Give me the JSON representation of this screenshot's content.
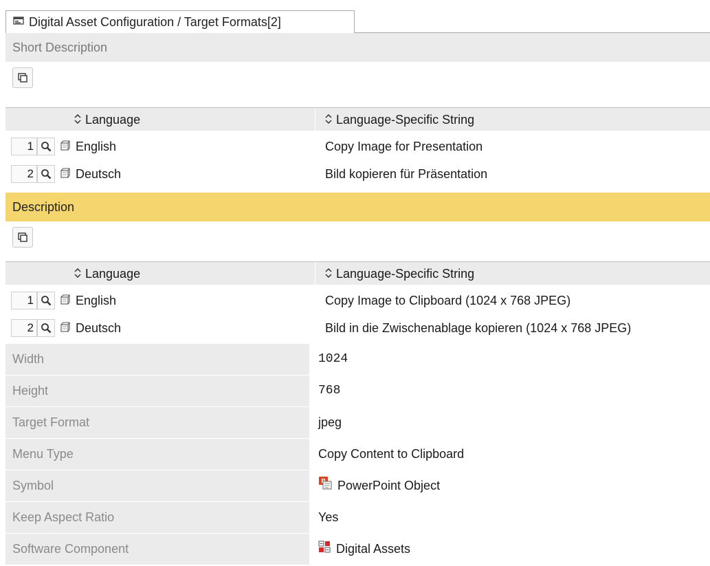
{
  "tab": {
    "title": "Digital Asset Configuration / Target Formats[2]",
    "icon": "form-window-icon"
  },
  "short_description": {
    "header": "Short Description",
    "columns": [
      "Language",
      "Language-Specific String"
    ],
    "rows": [
      {
        "num": "1",
        "language": "English",
        "text": "Copy Image for Presentation"
      },
      {
        "num": "2",
        "language": "Deutsch",
        "text": "Bild kopieren für Präsentation"
      }
    ]
  },
  "description": {
    "header": "Description",
    "columns": [
      "Language",
      "Language-Specific String"
    ],
    "rows": [
      {
        "num": "1",
        "language": "English",
        "text": "Copy Image to Clipboard (1024 x 768 JPEG)"
      },
      {
        "num": "2",
        "language": "Deutsch",
        "text": "Bild in die Zwischenablage kopieren (1024 x 768 JPEG)"
      }
    ]
  },
  "fields": {
    "width": {
      "label": "Width",
      "value": "1024"
    },
    "height": {
      "label": "Height",
      "value": "768"
    },
    "target_format": {
      "label": "Target Format",
      "value": "jpeg"
    },
    "menu_type": {
      "label": "Menu Type",
      "value": "Copy Content to Clipboard"
    },
    "symbol": {
      "label": "Symbol",
      "value": "PowerPoint Object",
      "icon": "powerpoint-icon"
    },
    "keep_aspect_ratio": {
      "label": "Keep Aspect Ratio",
      "value": "Yes"
    },
    "software_component": {
      "label": "Software Component",
      "value": "Digital Assets",
      "icon": "digital-assets-icon"
    }
  },
  "colors": {
    "section_highlight": "#f5d56e",
    "label_bg": "#ebebeb",
    "label_text": "#8a8a8a",
    "powerpoint_red": "#d24726"
  }
}
